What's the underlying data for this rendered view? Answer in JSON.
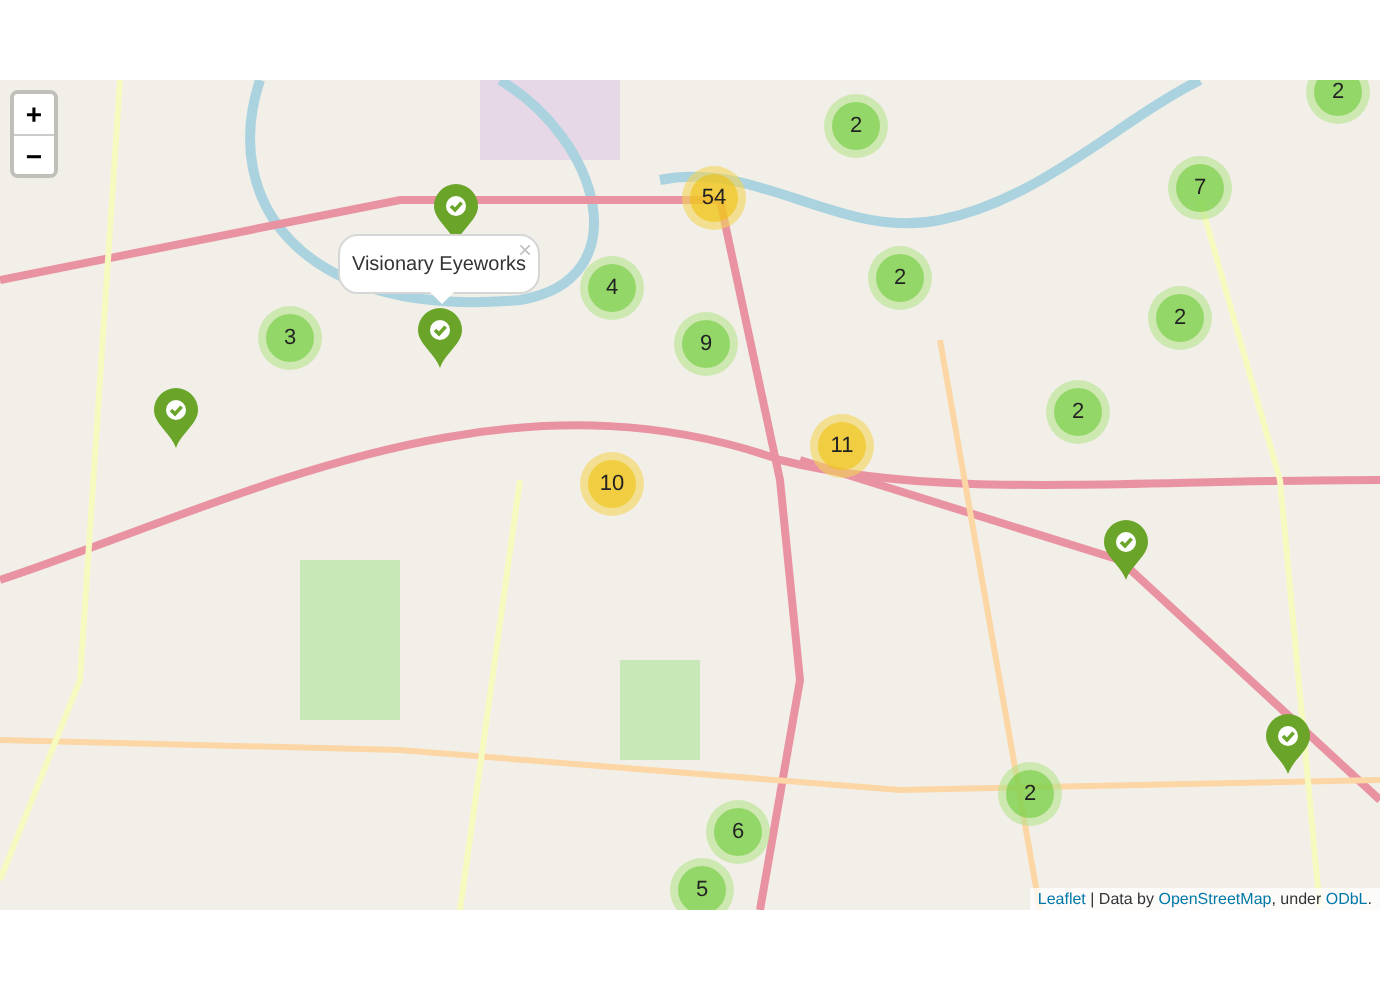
{
  "map": {
    "zoom_controls": [
      {
        "label": "+"
      },
      {
        "label": "−"
      }
    ],
    "clusters": [
      {
        "count": "2",
        "kind": "small"
      },
      {
        "count": "2",
        "kind": "small"
      },
      {
        "count": "54",
        "kind": "medium"
      },
      {
        "count": "7",
        "kind": "small"
      },
      {
        "count": "2",
        "kind": "small"
      },
      {
        "count": "4",
        "kind": "small"
      },
      {
        "count": "2",
        "kind": "small"
      },
      {
        "count": "3",
        "kind": "small"
      },
      {
        "count": "9",
        "kind": "small"
      },
      {
        "count": "2",
        "kind": "small"
      },
      {
        "count": "11",
        "kind": "medium"
      },
      {
        "count": "10",
        "kind": "medium"
      },
      {
        "count": "2",
        "kind": "small"
      },
      {
        "count": "6",
        "kind": "small"
      },
      {
        "count": "5",
        "kind": "small"
      }
    ],
    "pins": [
      {
        "selected": false
      },
      {
        "selected": true
      },
      {
        "selected": false
      },
      {
        "selected": false
      },
      {
        "selected": false
      }
    ],
    "popup": {
      "title": "Visionary Eyeworks",
      "close": "×"
    },
    "attribution": [
      {
        "kind": "link",
        "text": "Leaflet"
      },
      {
        "kind": "text",
        "text": " | Data by "
      },
      {
        "kind": "link",
        "text": "OpenStreetMap"
      },
      {
        "kind": "text",
        "text": ", under "
      },
      {
        "kind": "link",
        "text": "ODbL"
      },
      {
        "kind": "text",
        "text": "."
      }
    ]
  }
}
